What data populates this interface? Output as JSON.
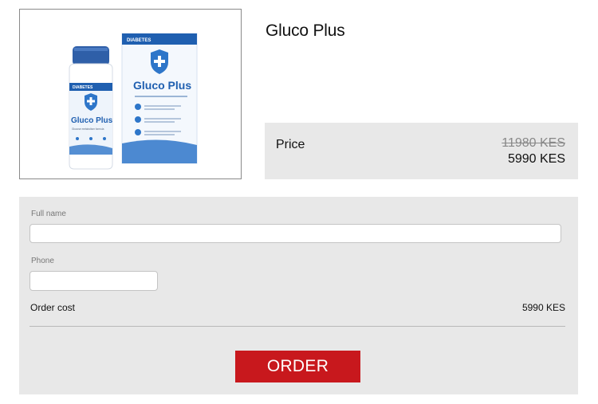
{
  "product": {
    "name": "Gluco Plus",
    "image": {
      "box_badge": "DIABETES",
      "box_brand": "Gluco Plus",
      "bottle_badge": "DIABETES",
      "bottle_brand": "Gluco Plus",
      "bottle_subtitle": "Glucose metabolism formula"
    }
  },
  "price": {
    "label": "Price",
    "old": "11980 KES",
    "new": "5990 KES"
  },
  "form": {
    "full_name_label": "Full name",
    "full_name_value": "",
    "phone_label": "Phone",
    "phone_value": "",
    "order_cost_label": "Order cost",
    "order_cost_value": "5990 KES",
    "submit_label": "ORDER"
  },
  "colors": {
    "accent": "#c8181d",
    "panel": "#e8e8e8",
    "brand_blue": "#1f5fb0"
  }
}
